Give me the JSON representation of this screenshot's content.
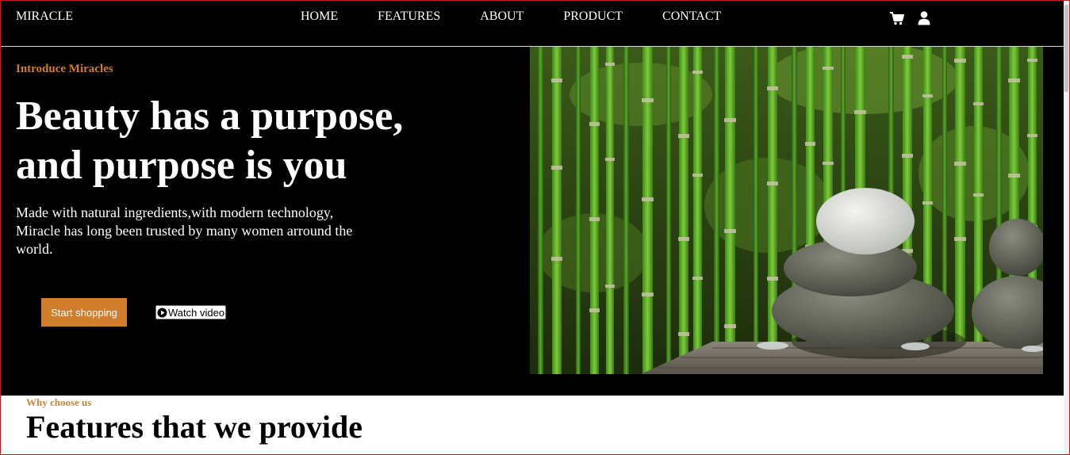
{
  "nav": {
    "brand": "MIRACLE",
    "items": [
      {
        "label": "HOME"
      },
      {
        "label": "FEATURES"
      },
      {
        "label": "ABOUT"
      },
      {
        "label": "PRODUCT"
      },
      {
        "label": "CONTACT"
      }
    ],
    "icons": [
      "cart-icon",
      "user-icon"
    ]
  },
  "hero": {
    "eyebrow": "Introduce Miracles",
    "headline": "Beauty has a purpose, and purpose is you",
    "description": "Made with natural ingredients,with modern technology, Miracle has long been trusted by many women arround the world.",
    "primary_button": "Start shopping",
    "secondary_button": "Watch video",
    "image": "bamboo-and-zen-stones-photo"
  },
  "features": {
    "eyebrow": "Why choose us",
    "title": "Features that we provide"
  },
  "colors": {
    "accent": "#d07d2c",
    "nav_bg": "#000000",
    "hero_bg": "#000000",
    "text_light": "#ffffff"
  }
}
